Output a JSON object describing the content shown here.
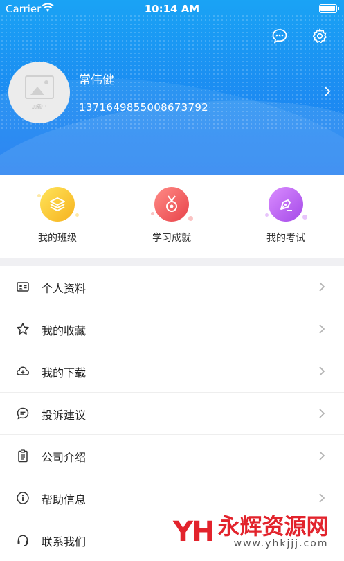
{
  "status_bar": {
    "carrier": "Carrier",
    "time": "10:14 AM"
  },
  "header": {
    "message_icon": "chat-bubble-icon",
    "settings_icon": "gear-icon",
    "avatar_caption": "加载中",
    "user_name": "常伟健",
    "user_id": "1371649855008673792"
  },
  "quick_actions": [
    {
      "label": "我的班级",
      "icon": "layers-icon",
      "color": "#f8c42c"
    },
    {
      "label": "学习成就",
      "icon": "medal-icon",
      "color": "#ef5a59"
    },
    {
      "label": "我的考试",
      "icon": "pen-nib-icon",
      "color": "#b85ef0"
    }
  ],
  "menu": [
    {
      "label": "个人资料",
      "icon": "id-card-icon"
    },
    {
      "label": "我的收藏",
      "icon": "star-icon"
    },
    {
      "label": "我的下载",
      "icon": "cloud-download-icon"
    },
    {
      "label": "投诉建议",
      "icon": "chat-icon"
    },
    {
      "label": "公司介绍",
      "icon": "clipboard-icon"
    },
    {
      "label": "帮助信息",
      "icon": "info-icon"
    },
    {
      "label": "联系我们",
      "icon": "headset-icon"
    }
  ],
  "watermark": {
    "mark": "YH",
    "title": "永辉资源网",
    "url": "www.yhkjjj.com"
  }
}
